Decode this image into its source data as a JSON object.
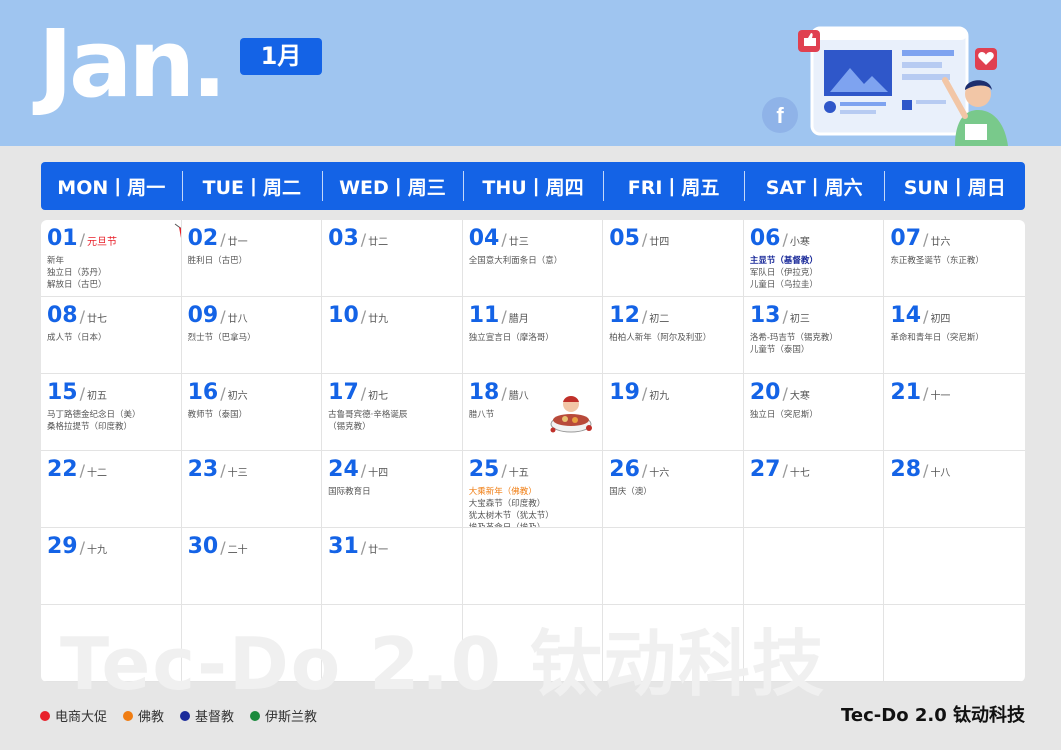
{
  "header": {
    "month_en": "Jan.",
    "month_cn": "1月"
  },
  "weekdays": [
    "MON丨周一",
    "TUE丨周二",
    "WED丨周三",
    "THU丨周四",
    "FRI丨周五",
    "SAT丨周六",
    "SUN丨周日"
  ],
  "days": [
    {
      "d": "01",
      "lunar": "元旦节",
      "lunar_color": "red",
      "events": [
        {
          "t": "新年"
        },
        {
          "t": "独立日（苏丹）"
        },
        {
          "t": "解放日（古巴）"
        }
      ]
    },
    {
      "d": "02",
      "lunar": "廿一",
      "events": [
        {
          "t": "胜利日（古巴）"
        }
      ]
    },
    {
      "d": "03",
      "lunar": "廿二",
      "events": []
    },
    {
      "d": "04",
      "lunar": "廿三",
      "events": [
        {
          "t": "全国意大利面条日（意）"
        }
      ]
    },
    {
      "d": "05",
      "lunar": "廿四",
      "events": []
    },
    {
      "d": "06",
      "lunar": "小寒",
      "events": [
        {
          "t": "主显节（基督教）",
          "c": "navy"
        },
        {
          "t": "军队日（伊拉克）"
        },
        {
          "t": "儿童日（乌拉圭）"
        }
      ]
    },
    {
      "d": "07",
      "lunar": "廿六",
      "events": [
        {
          "t": "东正教圣诞节（东正教）"
        }
      ]
    },
    {
      "d": "08",
      "lunar": "廿七",
      "events": [
        {
          "t": "成人节（日本）"
        }
      ]
    },
    {
      "d": "09",
      "lunar": "廿八",
      "events": [
        {
          "t": "烈士节（巴拿马）"
        }
      ]
    },
    {
      "d": "10",
      "lunar": "廿九",
      "events": []
    },
    {
      "d": "11",
      "lunar": "腊月",
      "events": [
        {
          "t": "独立宣言日（摩洛哥）"
        }
      ]
    },
    {
      "d": "12",
      "lunar": "初二",
      "events": [
        {
          "t": "柏柏人新年（阿尔及利亚）"
        }
      ]
    },
    {
      "d": "13",
      "lunar": "初三",
      "events": [
        {
          "t": "洛希-玛吉节（锡克教）"
        },
        {
          "t": "儿童节（泰国）"
        }
      ]
    },
    {
      "d": "14",
      "lunar": "初四",
      "events": [
        {
          "t": "革命和青年日（突尼斯）"
        }
      ]
    },
    {
      "d": "15",
      "lunar": "初五",
      "events": [
        {
          "t": "马丁路德金纪念日（美）"
        },
        {
          "t": "桑格拉提节（印度教）"
        }
      ]
    },
    {
      "d": "16",
      "lunar": "初六",
      "events": [
        {
          "t": "教师节（泰国）"
        }
      ]
    },
    {
      "d": "17",
      "lunar": "初七",
      "events": [
        {
          "t": "古鲁哥宾德·辛格诞辰"
        },
        {
          "t": "（锡克教）"
        }
      ]
    },
    {
      "d": "18",
      "lunar": "腊八",
      "events": [
        {
          "t": "腊八节"
        }
      ]
    },
    {
      "d": "19",
      "lunar": "初九",
      "events": []
    },
    {
      "d": "20",
      "lunar": "大寒",
      "events": [
        {
          "t": "独立日（突尼斯）"
        }
      ]
    },
    {
      "d": "21",
      "lunar": "十一",
      "events": []
    },
    {
      "d": "22",
      "lunar": "十二",
      "events": []
    },
    {
      "d": "23",
      "lunar": "十三",
      "events": []
    },
    {
      "d": "24",
      "lunar": "十四",
      "events": [
        {
          "t": "国际教育日"
        }
      ]
    },
    {
      "d": "25",
      "lunar": "十五",
      "events": [
        {
          "t": "大乘新年（佛教）",
          "c": "orange"
        },
        {
          "t": "大宝森节（印度教）"
        },
        {
          "t": "犹太树木节（犹太节）"
        },
        {
          "t": "埃及革命日（埃及）"
        }
      ]
    },
    {
      "d": "26",
      "lunar": "十六",
      "events": [
        {
          "t": "国庆（澳）"
        }
      ]
    },
    {
      "d": "27",
      "lunar": "十七",
      "events": []
    },
    {
      "d": "28",
      "lunar": "十八",
      "events": []
    },
    {
      "d": "29",
      "lunar": "十九",
      "events": []
    },
    {
      "d": "30",
      "lunar": "二十",
      "events": []
    },
    {
      "d": "31",
      "lunar": "廿一",
      "events": []
    }
  ],
  "watermark": "Tec-Do 2.0 钛动科技",
  "legend": [
    {
      "label": "电商大促",
      "color": "#e8202a"
    },
    {
      "label": "佛教",
      "color": "#f07d12"
    },
    {
      "label": "基督教",
      "color": "#1b2b9a"
    },
    {
      "label": "伊斯兰教",
      "color": "#1a8a3c"
    }
  ],
  "brand": "Tec-Do 2.0 钛动科技",
  "colors": {
    "accent": "#1463e6",
    "header_bg": "#9fc5f0",
    "page_bg": "#e6e6e6"
  }
}
